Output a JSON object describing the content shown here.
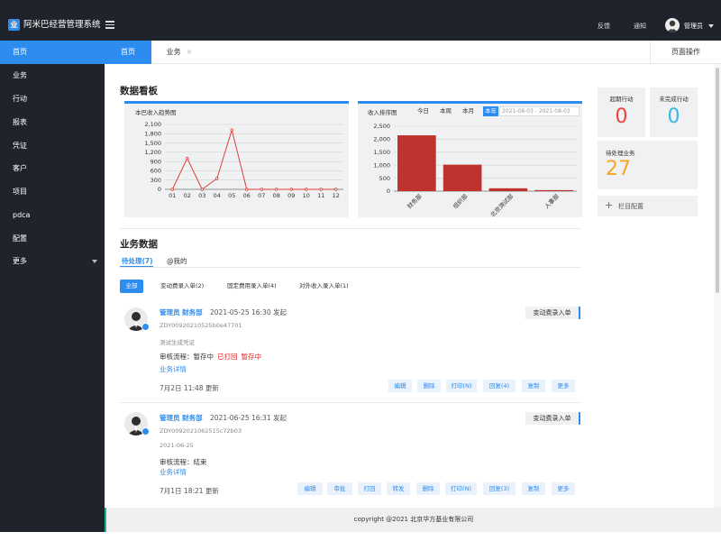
{
  "app": {
    "title": "阿米巴经营管理系统",
    "logo_char": "业"
  },
  "topbar": {
    "feedback": "反馈",
    "notice": "通知",
    "user": "管理员"
  },
  "sidebar": {
    "items": [
      "首页",
      "业务",
      "行动",
      "报表",
      "凭证",
      "客户",
      "项目",
      "pdca",
      "配置",
      "更多"
    ],
    "active_index": 0
  },
  "tabs": {
    "items": [
      {
        "label": "首页",
        "active": true
      },
      {
        "label": "业务",
        "closable": true
      }
    ],
    "page_ops": "页面操作",
    "close_glyph": "×"
  },
  "dashboard": {
    "title": "数据看板",
    "trend": {
      "title": "本巴收入趋势图",
      "y_ticks": [
        "2,100",
        "1,800",
        "1,500",
        "1,200",
        "900",
        "600",
        "300",
        "0"
      ],
      "x_ticks": [
        "01",
        "02",
        "03",
        "04",
        "05",
        "06",
        "07",
        "08",
        "09",
        "10",
        "11",
        "12"
      ]
    },
    "ranking": {
      "title": "收入排序图",
      "ranges": [
        "今日",
        "本周",
        "本月",
        "本年"
      ],
      "active_range": 3,
      "date_range": "2021-08-03 - 2021-08-03",
      "y_ticks": [
        "2,500",
        "2,000",
        "1,500",
        "1,000",
        "500",
        "0"
      ],
      "x_ticks": [
        "财务部",
        "组织部",
        "北京测试部",
        "人事部"
      ]
    },
    "stats": [
      {
        "label": "超期行动",
        "value": "0",
        "color": "#e8463c"
      },
      {
        "label": "未完成行动",
        "value": "0",
        "color": "#3fb5e6"
      },
      {
        "label": "待处理业务",
        "value": "27",
        "color": "#f5a623"
      }
    ],
    "config": {
      "icon": "plus-icon",
      "glyph": "+",
      "label": "栏目配置"
    }
  },
  "chart_data": [
    {
      "type": "line",
      "title": "本巴收入趋势图",
      "x": [
        "01",
        "02",
        "03",
        "04",
        "05",
        "06",
        "07",
        "08",
        "09",
        "10",
        "11",
        "12"
      ],
      "series": [
        {
          "values": [
            0,
            1000,
            0,
            350,
            1920,
            0,
            0,
            0,
            0,
            0,
            0,
            0
          ],
          "color": "#d9413a"
        }
      ],
      "ylim": [
        0,
        2100
      ],
      "grid": true
    },
    {
      "type": "bar",
      "title": "收入排序图",
      "categories": [
        "财务部",
        "组织部",
        "北京测试部",
        "人事部"
      ],
      "values": [
        2150,
        1020,
        110,
        40
      ],
      "color": "#c0322d",
      "ylim": [
        0,
        2500
      ],
      "grid": true
    }
  ],
  "business": {
    "title": "业务数据",
    "subtabs": [
      "待处理(7)",
      "@我的"
    ],
    "filters": [
      "全部",
      "变动费录入单(2)",
      "固定费用录入单(4)",
      "对外收入录入单(1)"
    ],
    "items": [
      {
        "user": "管理员 财务部",
        "time": "2021-05-25 16:30 发起",
        "code": "ZDY00920210525b0e47701",
        "desc": "测试生成凭证",
        "flow_label": "审核流程：暂存中",
        "flow_tags": [
          "已打回",
          "暂存中"
        ],
        "link": "业务详情",
        "updated": "7月2日 11:48 更新",
        "type": "变动费录入单",
        "actions": [
          "编辑",
          "删除",
          "打印(N)",
          "回复(4)",
          "复制",
          "更多"
        ]
      },
      {
        "user": "管理员 财务部",
        "time": "2021-06-25 16:31 发起",
        "code": "ZDY0092021062515c72b03",
        "desc": "2021-06-25",
        "flow_label": "审核流程：结束",
        "flow_tags": [],
        "link": "业务详情",
        "updated": "7月1日 18:21 更新",
        "type": "变动费录入单",
        "actions": [
          "编辑",
          "审批",
          "打回",
          "转发",
          "删除",
          "打印(N)",
          "回复(3)",
          "复制",
          "更多"
        ]
      }
    ]
  },
  "footer": {
    "text": "copyright @2021 北京华方基业有限公司"
  }
}
